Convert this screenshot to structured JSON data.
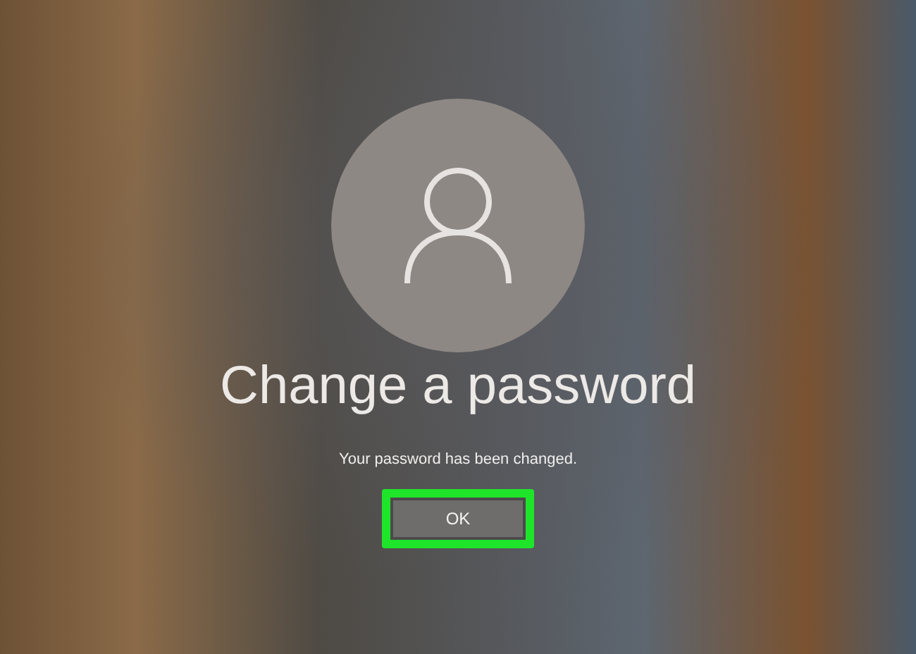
{
  "title": "Change a password",
  "message": "Your password has been changed.",
  "ok_button": {
    "label": "OK",
    "highlighted": true
  }
}
